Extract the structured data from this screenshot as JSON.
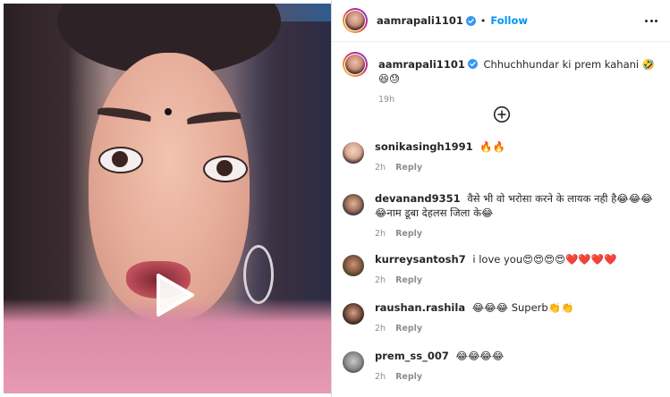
{
  "post": {
    "author": {
      "username": "aamrapali1101",
      "verified": true,
      "follow_label": "Follow",
      "separator": "•"
    },
    "media": {
      "type": "video",
      "play_icon": "play-icon"
    },
    "caption": {
      "username": "aamrapali1101",
      "text": "Chhuchhundar ki prem kahani 🤣😆😓",
      "time": "19h"
    },
    "load_more_icon": "plus-circle-icon",
    "more_icon": "more-horizontal-icon",
    "comments": [
      {
        "username": "sonikasingh1991",
        "text": "🔥🔥",
        "time": "2h",
        "reply_label": "Reply"
      },
      {
        "username": "devanand9351",
        "text": "वैसे भी वो भरोसा करने के लायक नही है😂😂😂😂नाम डूबा देहलस जिला के😂",
        "time": "2h",
        "reply_label": "Reply"
      },
      {
        "username": "kurreysantosh7",
        "text": "i love you😍😍😍😍❤️❤️❤️❤️",
        "time": "2h",
        "reply_label": "Reply"
      },
      {
        "username": "raushan.rashila",
        "text": "😂😂😂 Superb👏👏",
        "time": "2h",
        "reply_label": "Reply"
      },
      {
        "username": "prem_ss_007",
        "text": "😂😂😂😂",
        "time": "2h",
        "reply_label": "Reply"
      }
    ],
    "colors": {
      "link_blue": "#0095f6",
      "text": "#262626",
      "muted": "#8e8e8e",
      "divider": "#efefef"
    }
  }
}
